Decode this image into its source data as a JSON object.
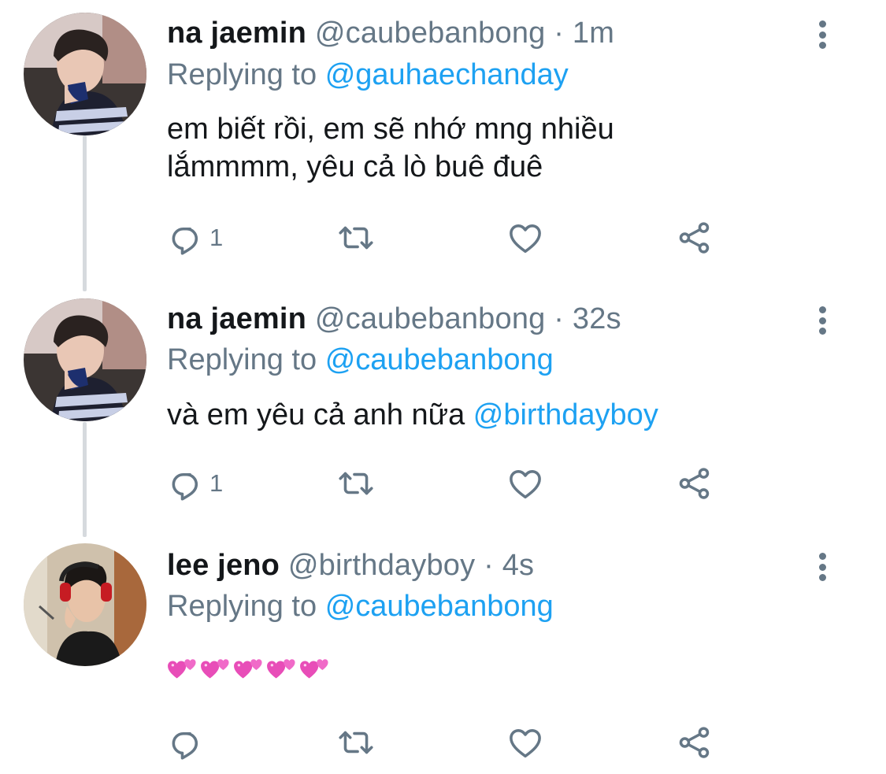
{
  "tweets": [
    {
      "name": "na jaemin",
      "handle": "@caubebanbong",
      "dot": "·",
      "time": "1m",
      "replying_label": "Replying to",
      "replying_to": "@gauhaechanday",
      "text_line1": "em biết rồi, em sẽ nhớ mng nhiều",
      "text_line2": "lắmmmm, yêu cả lò buê đuê",
      "reply_count": "1",
      "avatar": "na-jaemin-avatar"
    },
    {
      "name": "na jaemin",
      "handle": "@caubebanbong",
      "dot": "·",
      "time": "32s",
      "replying_label": "Replying to",
      "replying_to": "@caubebanbong",
      "text": "và em yêu cả anh nữa",
      "text_mention": "@birthdayboy",
      "reply_count": "1",
      "avatar": "na-jaemin-avatar"
    },
    {
      "name": "lee jeno",
      "handle": "@birthdayboy",
      "dot": "·",
      "time": "4s",
      "replying_label": "Replying to",
      "replying_to": "@caubebanbong",
      "emoji": "💞💞💞💞💞",
      "reply_count": "",
      "avatar": "lee-jeno-avatar"
    }
  ],
  "icons": {
    "reply": "reply-icon",
    "retweet": "retweet-icon",
    "like": "heart-icon",
    "share": "share-icon",
    "more": "more-options-icon"
  },
  "colors": {
    "text": "#14171a",
    "secondary": "#657786",
    "link": "#1da1f2",
    "thread_line": "#d6dade",
    "heart_emoji": "#e84db8"
  }
}
